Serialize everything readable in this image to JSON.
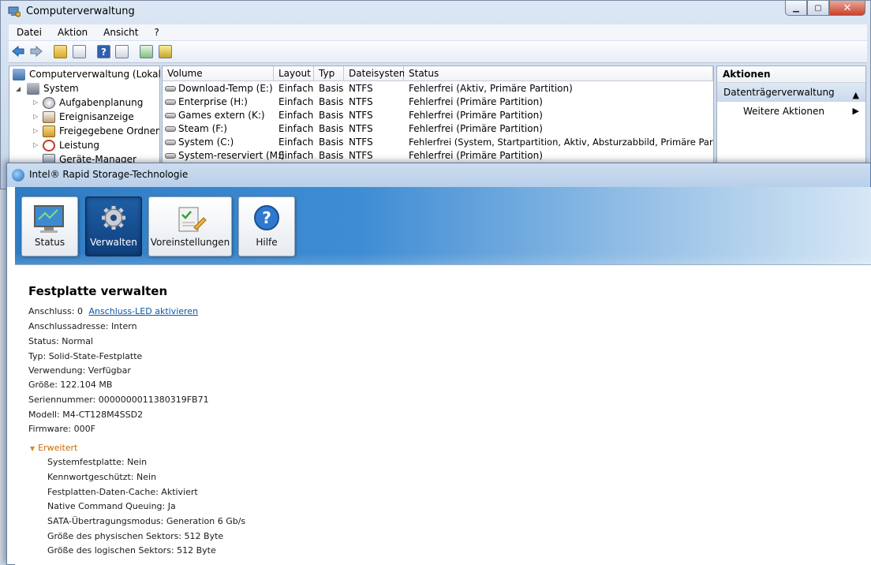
{
  "computer_management": {
    "window_title": "Computerverwaltung",
    "menu": [
      "Datei",
      "Aktion",
      "Ansicht",
      "?"
    ],
    "tree": {
      "root": "Computerverwaltung (Lokal)",
      "system": "System",
      "items": [
        "Aufgabenplanung",
        "Ereignisanzeige",
        "Freigegebene Ordner",
        "Leistung",
        "Geräte-Manager"
      ]
    },
    "table": {
      "columns": [
        "Volume",
        "Layout",
        "Typ",
        "Dateisystem",
        "Status"
      ],
      "rows": [
        [
          "Download-Temp (E:)",
          "Einfach",
          "Basis",
          "NTFS",
          "Fehlerfrei (Aktiv, Primäre Partition)"
        ],
        [
          "Enterprise (H:)",
          "Einfach",
          "Basis",
          "NTFS",
          "Fehlerfrei (Primäre Partition)"
        ],
        [
          "Games extern (K:)",
          "Einfach",
          "Basis",
          "NTFS",
          "Fehlerfrei (Primäre Partition)"
        ],
        [
          "Steam (F:)",
          "Einfach",
          "Basis",
          "NTFS",
          "Fehlerfrei (Primäre Partition)"
        ],
        [
          "System (C:)",
          "Einfach",
          "Basis",
          "NTFS",
          "Fehlerfrei (System, Startpartition, Aktiv, Absturzabbild, Primäre Partition)"
        ],
        [
          "System-reserviert (M:)",
          "Einfach",
          "Basis",
          "NTFS",
          "Fehlerfrei (Primäre Partition)"
        ]
      ]
    },
    "actions": {
      "header": "Aktionen",
      "section": "Datenträgerverwaltung",
      "more": "Weitere Aktionen"
    }
  },
  "rst": {
    "window_title": "Intel® Rapid Storage-Technologie",
    "nav": {
      "status": "Status",
      "manage": "Verwalten",
      "preferences": "Voreinstellungen",
      "help": "Hilfe"
    },
    "heading": "Festplatte verwalten",
    "port_label": "Anschluss: 0",
    "port_led_link": "Anschluss-LED aktivieren",
    "properties": [
      "Anschlussadresse: Intern",
      "Status: Normal",
      "Typ: Solid-State-Festplatte",
      "Verwendung: Verfügbar",
      "Größe: 122.104 MB",
      "Seriennummer: 0000000011380319FB71",
      "Modell: M4-CT128M4SSD2",
      "Firmware: 000F"
    ],
    "advanced_label": "Erweitert",
    "advanced_properties": [
      "Systemfestplatte: Nein",
      "Kennwortgeschützt: Nein",
      "Festplatten-Daten-Cache: Aktiviert",
      "Native Command Queuing: Ja",
      "SATA-Übertragungsmodus: Generation 6 Gb/s",
      "Größe des physischen Sektors: 512 Byte",
      "Größe des logischen Sektors: 512 Byte"
    ]
  }
}
